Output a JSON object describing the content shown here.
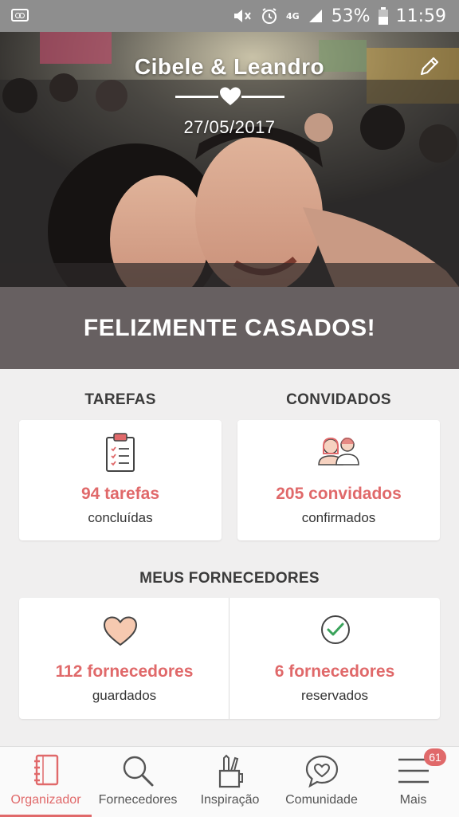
{
  "status_bar": {
    "battery": "53%",
    "time": "11:59",
    "network": "4G"
  },
  "hero": {
    "couple_names": "Cibele & Leandro",
    "wedding_date": "27/05/2017"
  },
  "banner": {
    "text": "FELIZMENTE CASADOS!"
  },
  "sections": {
    "tasks": {
      "title": "TAREFAS",
      "value": "94 tarefas",
      "subtitle": "concluídas"
    },
    "guests": {
      "title": "CONVIDADOS",
      "value": "205 convidados",
      "subtitle": "confirmados"
    },
    "vendors": {
      "title": "MEUS FORNECEDORES",
      "saved_value": "112 fornecedores",
      "saved_subtitle": "guardados",
      "booked_value": "6 fornecedores",
      "booked_subtitle": "reservados"
    }
  },
  "bottom_nav": {
    "items": [
      {
        "label": "Organizador",
        "icon": "notebook-icon",
        "active": true
      },
      {
        "label": "Fornecedores",
        "icon": "search-icon",
        "active": false
      },
      {
        "label": "Inspiração",
        "icon": "pencil-cup-icon",
        "active": false
      },
      {
        "label": "Comunidade",
        "icon": "chat-heart-icon",
        "active": false
      },
      {
        "label": "Mais",
        "icon": "menu-icon",
        "active": false
      }
    ],
    "more_badge": "61"
  },
  "colors": {
    "accent": "#e0696a",
    "banner_bg": "#676061",
    "status_bar_bg": "#8e8e8e",
    "page_bg": "#f0efef"
  }
}
